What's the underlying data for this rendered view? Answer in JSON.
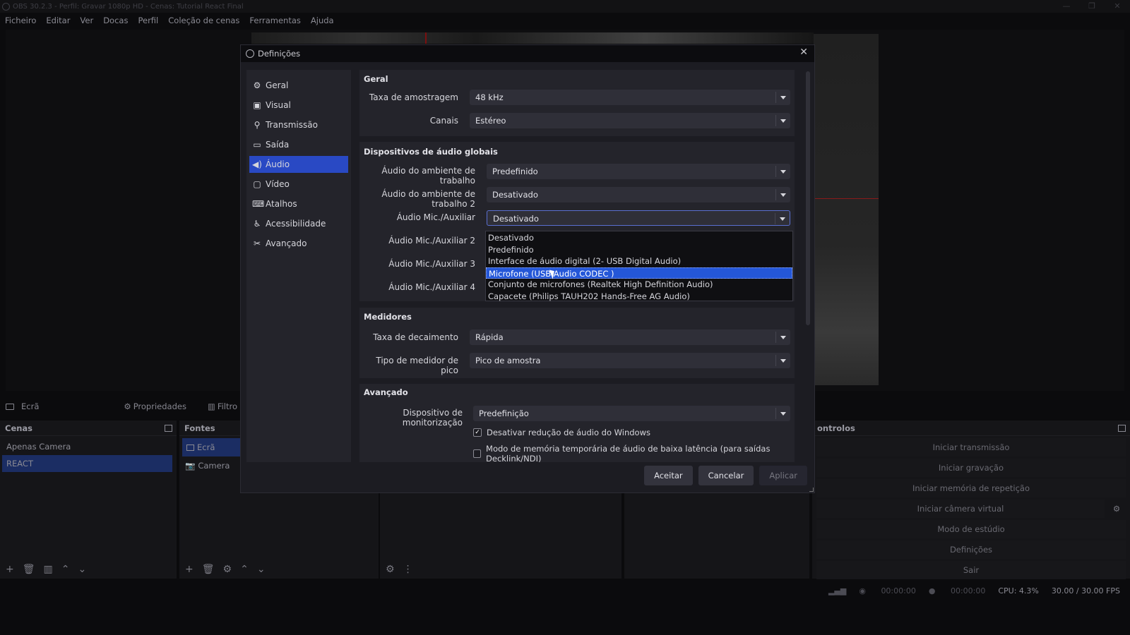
{
  "window": {
    "title": "OBS 30.2.3 - Perfil: Gravar 1080p HD - Cenas: Tutorial React Final"
  },
  "menubar": [
    "Ficheiro",
    "Editar",
    "Ver",
    "Docas",
    "Perfil",
    "Coleção de cenas",
    "Ferramentas",
    "Ajuda"
  ],
  "source_toolbar": {
    "source": "Ecrã",
    "properties": "Propriedades",
    "filters": "Filtro"
  },
  "scenes": {
    "title": "Cenas",
    "items": [
      "Apenas Camera",
      "REACT"
    ],
    "selected": "REACT"
  },
  "sources": {
    "title": "Fontes",
    "items": [
      "Ecrã",
      "Camera"
    ],
    "selected": "Ecrã"
  },
  "controls": {
    "title": "ontrolos",
    "buttons": [
      "Iniciar transmissão",
      "Iniciar gravação",
      "Iniciar memória de repetição",
      "Iniciar câmera virtual",
      "Modo de estúdio",
      "Definições",
      "Sair"
    ]
  },
  "statusbar": {
    "stream_time": "00:00:00",
    "rec_time": "00:00:00",
    "cpu": "CPU: 4.3%",
    "fps": "30.00 / 30.00 FPS"
  },
  "dialog": {
    "title": "Definições",
    "sidebar": [
      {
        "label": "Geral",
        "icon": "gear-icon"
      },
      {
        "label": "Visual",
        "icon": "palette-icon"
      },
      {
        "label": "Transmissão",
        "icon": "antenna-icon"
      },
      {
        "label": "Saída",
        "icon": "output-icon"
      },
      {
        "label": "Áudio",
        "icon": "speaker-icon"
      },
      {
        "label": "Vídeo",
        "icon": "monitor-icon"
      },
      {
        "label": "Atalhos",
        "icon": "keyboard-icon"
      },
      {
        "label": "Acessibilidade",
        "icon": "accessibility-icon"
      },
      {
        "label": "Avançado",
        "icon": "tools-icon"
      }
    ],
    "selected_section": "Áudio",
    "general": {
      "title": "Geral",
      "sample_rate_label": "Taxa de amostragem",
      "sample_rate_value": "48 kHz",
      "channels_label": "Canais",
      "channels_value": "Estéreo"
    },
    "global_devices": {
      "title": "Dispositivos de áudio globais",
      "desktop1_label": "Áudio do ambiente de trabalho",
      "desktop1_value": "Predefinido",
      "desktop2_label": "Áudio do ambiente de trabalho 2",
      "desktop2_value": "Desativado",
      "mic1_label": "Áudio Mic./Auxiliar",
      "mic1_value": "Desativado",
      "mic2_label": "Áudio Mic./Auxiliar 2",
      "mic3_label": "Áudio Mic./Auxiliar 3",
      "mic4_label": "Áudio Mic./Auxiliar 4"
    },
    "dropdown_options": [
      "Desativado",
      "Predefinido",
      "Interface de áudio digital (2- USB Digital Audio)",
      "Microfone (USB Audio CODEC )",
      "Conjunto de microfones (Realtek High Definition Audio)",
      "Capacete (Philips TAUH202 Hands-Free AG Audio)"
    ],
    "dropdown_highlighted": "Microfone (USB Audio CODEC )",
    "meters": {
      "title": "Medidores",
      "decay_label": "Taxa de decaimento",
      "decay_value": "Rápida",
      "peak_label": "Tipo de medidor de pico",
      "peak_value": "Pico de amostra"
    },
    "advanced": {
      "title": "Avançado",
      "monitor_label": "Dispositivo de monitorização",
      "monitor_value": "Predefinição",
      "ducking_label": "Desativar redução de áudio do Windows",
      "ducking_checked": true,
      "lowlat_label": "Modo de memória temporária de áudio de baixa latência (para saídas Decklink/NDI)",
      "lowlat_checked": false
    },
    "buttons": {
      "ok": "Aceitar",
      "cancel": "Cancelar",
      "apply": "Aplicar"
    }
  }
}
